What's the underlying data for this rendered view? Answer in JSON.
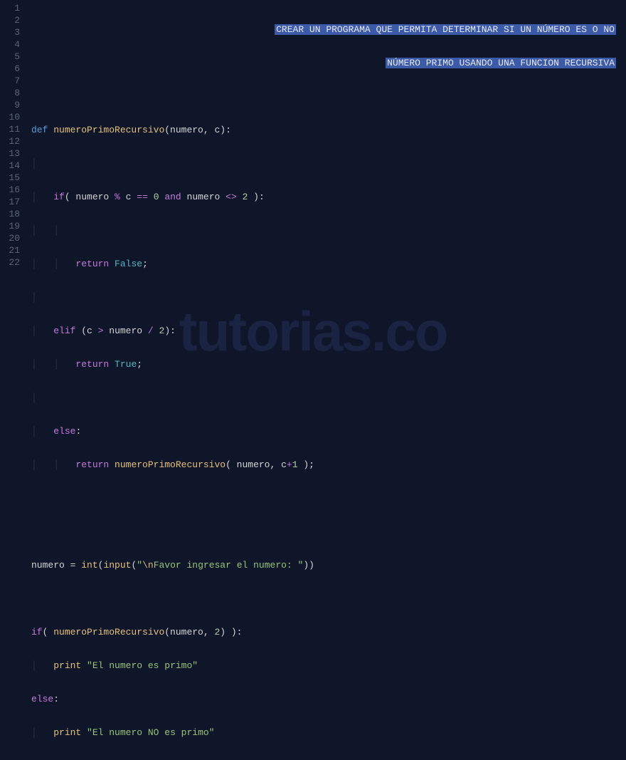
{
  "watermark": "tutorias.co",
  "gutter": {
    "start": 1,
    "end": 22
  },
  "code": {
    "comment_line1": "CREAR UN PROGRAMA QUE PERMITA DETERMINAR SI UN NÚMERO ES O NO",
    "comment_line2": "NÚMERO PRIMO USANDO UNA FUNCION RECURSIVA",
    "l4_def": "def",
    "l4_func": "numeroPrimoRecursivo",
    "l4_params": "(numero, c):",
    "l6_if": "if",
    "l6_expr_a": "( numero ",
    "l6_mod": "%",
    "l6_c": " c ",
    "l6_eq": "==",
    "l6_sp": " ",
    "l6_zero": "0",
    "l6_and": "and",
    "l6_num2": " numero ",
    "l6_ne": "<>",
    "l6_two": "2",
    "l6_close": " ):",
    "l8_return": "return",
    "l8_false": "False",
    "l8_semi": ";",
    "l10_elif": "elif",
    "l10_open": " (c ",
    "l10_gt": ">",
    "l10_num": " numero ",
    "l10_div": "/",
    "l10_two": "2",
    "l10_close": "):",
    "l11_return": "return",
    "l11_true": "True",
    "l11_semi": ";",
    "l13_else": "else",
    "l13_colon": ":",
    "l14_return": "return",
    "l14_func": "numeroPrimoRecursivo",
    "l14_open": "( numero, c",
    "l14_plus": "+",
    "l14_one": "1",
    "l14_close": " );",
    "l17_numero": "numero",
    "l17_eq": " = ",
    "l17_int": "int",
    "l17_input": "input",
    "l17_op": "(",
    "l17_str_esc": "\\n",
    "l17_str": "Favor ingresar el numero: ",
    "l17_q": "\"",
    "l17_close": "))",
    "l19_if": "if",
    "l19_open": "( ",
    "l19_func": "numeroPrimoRecursivo",
    "l19_args": "(numero, ",
    "l19_two": "2",
    "l19_close": ") ):",
    "l20_print": "print",
    "l20_str": "\"El numero es primo\"",
    "l21_else": "else",
    "l21_colon": ":",
    "l22_print": "print",
    "l22_str": "\"El numero NO es primo\""
  }
}
